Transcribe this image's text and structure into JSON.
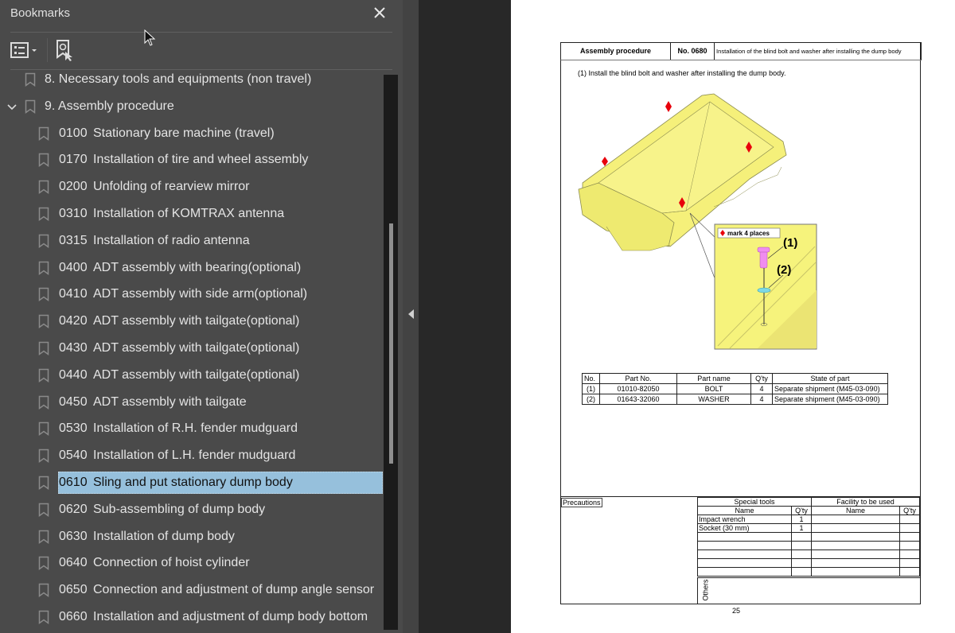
{
  "sidebar": {
    "title": "Bookmarks",
    "close_icon": "close-icon",
    "toolbar": {
      "options_icon": "options-list-icon",
      "find_bookmark_icon": "find-current-bookmark-icon"
    },
    "items": [
      {
        "level": 1,
        "expanded": null,
        "number": "",
        "label": "8. Necessary tools and equipments (non travel)"
      },
      {
        "level": 1,
        "expanded": true,
        "number": "",
        "label": "9. Assembly procedure"
      },
      {
        "level": 2,
        "number": "0100",
        "label": "Stationary bare machine (travel)"
      },
      {
        "level": 2,
        "number": "0170",
        "label": "Installation of tire and wheel assembly"
      },
      {
        "level": 2,
        "number": "0200",
        "label": "Unfolding of rearview mirror"
      },
      {
        "level": 2,
        "number": "0310",
        "label": "Installation of KOMTRAX antenna"
      },
      {
        "level": 2,
        "number": "0315",
        "label": "Installation of radio antenna"
      },
      {
        "level": 2,
        "number": "0400",
        "label": "ADT assembly with bearing(optional)"
      },
      {
        "level": 2,
        "number": "0410",
        "label": "ADT assembly with side arm(optional)"
      },
      {
        "level": 2,
        "number": "0420",
        "label": "ADT assembly with tailgate(optional)"
      },
      {
        "level": 2,
        "number": "0430",
        "label": "ADT assembly with tailgate(optional)"
      },
      {
        "level": 2,
        "number": "0440",
        "label": "ADT assembly with tailgate(optional)"
      },
      {
        "level": 2,
        "number": "0450",
        "label": "ADT assembly with tailgate"
      },
      {
        "level": 2,
        "number": "0530",
        "label": "Installation of R.H. fender mudguard"
      },
      {
        "level": 2,
        "number": "0540",
        "label": "Installation of L.H. fender mudguard"
      },
      {
        "level": 2,
        "number": "0610",
        "label": "Sling and put stationary dump body",
        "selected": true
      },
      {
        "level": 2,
        "number": "0620",
        "label": "Sub-assembling of dump body"
      },
      {
        "level": 2,
        "number": "0630",
        "label": "Installation of dump body"
      },
      {
        "level": 2,
        "number": "0640",
        "label": "Connection of hoist cylinder"
      },
      {
        "level": 2,
        "number": "0650",
        "label": "Connection and adjustment of dump angle sensor"
      },
      {
        "level": 2,
        "number": "0660",
        "label": "Installation and adjustment of dump body bottom"
      }
    ],
    "selected_color": "#96c0dc"
  },
  "document": {
    "header": {
      "section": "Assembly procedure",
      "number": "No. 0680",
      "title": "Installation of the blind bolt and washer after installing the dump body"
    },
    "step": "(1) Install the blind bolt and washer after installing the dump body.",
    "figure": {
      "legend": "mark 4 places",
      "callout_1": "(1)",
      "callout_2": "(2)",
      "body_color": "#f5f07a",
      "marker_color": "#e8000b"
    },
    "parts_table": {
      "headers": [
        "No.",
        "Part No.",
        "Part name",
        "Q'ty",
        "State of part"
      ],
      "rows": [
        [
          "(1)",
          "01010-82050",
          "BOLT",
          "4",
          "Separate shipment (M45-03-090)"
        ],
        [
          "(2)",
          "01643-32060",
          "WASHER",
          "4",
          "Separate shipment (M45-03-090)"
        ]
      ]
    },
    "precautions_label": "Precautions",
    "tools_table": {
      "special_tools": "Special tools",
      "facility": "Facility to be used",
      "name": "Name",
      "qty": "Q'ty",
      "rows": [
        [
          "Impact wrench",
          "1",
          "",
          ""
        ],
        [
          "Socket (30 mm)",
          "1",
          "",
          ""
        ],
        [
          "",
          "",
          "",
          ""
        ],
        [
          "",
          "",
          "",
          ""
        ],
        [
          "",
          "",
          "",
          ""
        ],
        [
          "",
          "",
          "",
          ""
        ],
        [
          "",
          "",
          "",
          ""
        ]
      ]
    },
    "others_label": "Others",
    "page_number": "25"
  }
}
